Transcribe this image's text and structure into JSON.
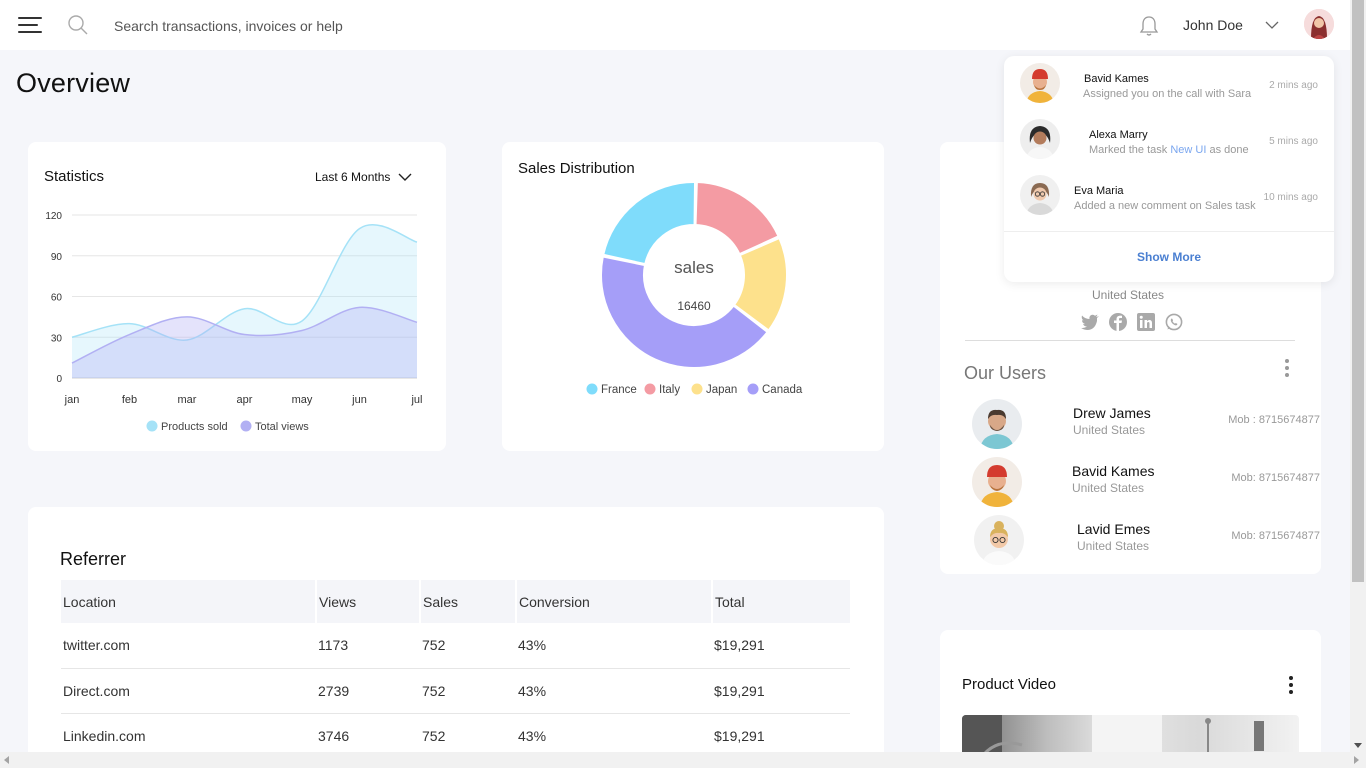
{
  "header": {
    "search_placeholder": "Search transactions, invoices or help",
    "user_name": "John Doe"
  },
  "page_title": "Overview",
  "statistics": {
    "title": "Statistics",
    "range": "Last 6 Months",
    "chart_data": {
      "type": "area",
      "categories": [
        "jan",
        "feb",
        "mar",
        "apr",
        "may",
        "jun",
        "jul"
      ],
      "series": [
        {
          "name": "Products sold",
          "color": "#a5e2f7",
          "values": [
            30,
            40,
            28,
            51,
            42,
            110,
            100
          ]
        },
        {
          "name": "Total views",
          "color": "#b2b0f3",
          "values": [
            11,
            32,
            45,
            32,
            35,
            52,
            41
          ]
        }
      ],
      "yticks": [
        "120",
        "90",
        "60",
        "30",
        "0"
      ],
      "ylim": [
        0,
        120
      ]
    }
  },
  "sales": {
    "title": "Sales Distribution",
    "center_label": "sales",
    "center_value": "16460",
    "chart_data": {
      "type": "pie",
      "labels": [
        "France",
        "Italy",
        "Japan",
        "Canada"
      ],
      "values": [
        22,
        18,
        17,
        43
      ],
      "colors": [
        "#7fdcfb",
        "#f49ba3",
        "#fde18c",
        "#a59ef8"
      ]
    }
  },
  "profile": {
    "country": "United States"
  },
  "users": {
    "title": "Our Users",
    "list": [
      {
        "name": "Drew James",
        "country": "United States",
        "mobile": "Mob : 8715674877"
      },
      {
        "name": "Bavid Kames",
        "country": "United States",
        "mobile": "Mob: 8715674877"
      },
      {
        "name": "Lavid Emes",
        "country": "United States",
        "mobile": "Mob: 8715674877"
      }
    ]
  },
  "notifications": {
    "items": [
      {
        "name": "Bavid Kames",
        "message": "Assigned you on the call with Sara",
        "time": "2 mins ago"
      },
      {
        "name": "Alexa Marry",
        "message_before": "Marked the task ",
        "message_highlight": "New UI",
        "message_after": " as done",
        "time": "5 mins ago"
      },
      {
        "name": "Eva Maria",
        "message": "Added a new comment on Sales task",
        "time": "10 mins ago"
      }
    ],
    "show_more": "Show More"
  },
  "referrer": {
    "title": "Referrer",
    "columns": [
      "Location",
      "Views",
      "Sales",
      "Conversion",
      "Total"
    ],
    "rows": [
      [
        "twitter.com",
        "1173",
        "752",
        "43%",
        "$19,291"
      ],
      [
        "Direct.com",
        "2739",
        "752",
        "43%",
        "$19,291"
      ],
      [
        "Linkedin.com",
        "3746",
        "752",
        "43%",
        "$19,291"
      ]
    ]
  },
  "product_video": {
    "title": "Product Video"
  }
}
